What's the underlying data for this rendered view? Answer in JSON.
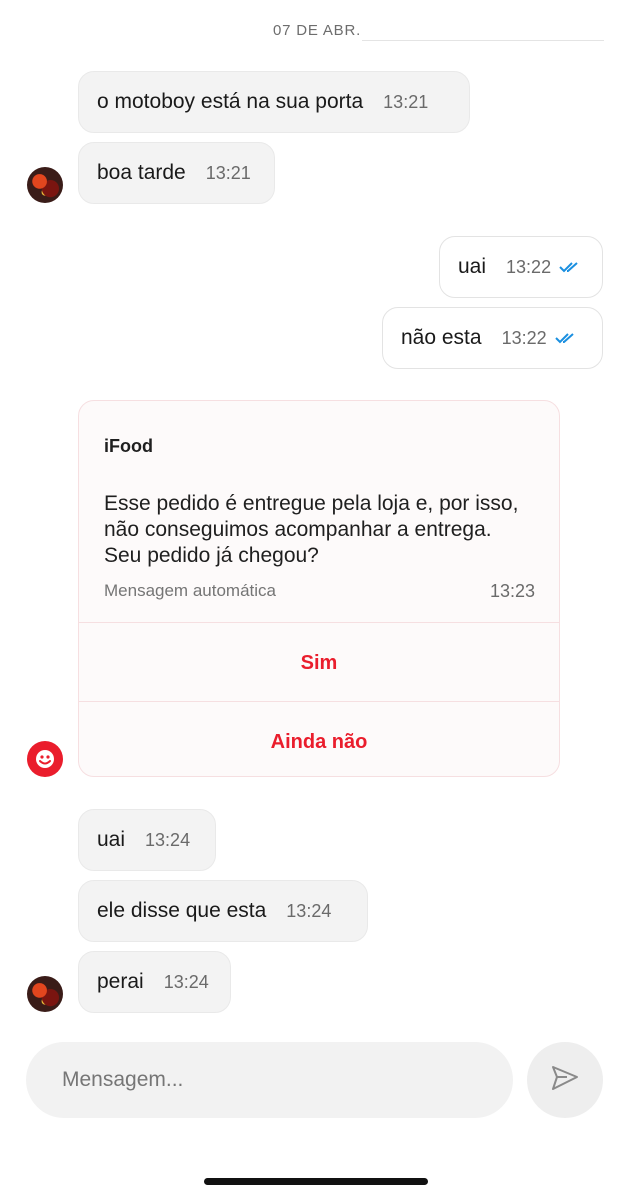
{
  "date_separator": "07 DE ABR.",
  "messages_top": [
    {
      "text": "o motoboy está na sua porta",
      "time": "13:21"
    },
    {
      "text": "boa tarde",
      "time": "13:21"
    }
  ],
  "messages_sent": [
    {
      "text": "uai",
      "time": "13:22",
      "status": "read"
    },
    {
      "text": "não esta",
      "time": "13:22",
      "status": "read"
    }
  ],
  "ifood_card": {
    "sender": "iFood",
    "text": "Esse pedido é entregue pela loja e, por isso, não conseguimos acompanhar a entrega. Seu pedido já chegou?",
    "auto_label": "Mensagem automática",
    "time": "13:23",
    "options": [
      "Sim",
      "Ainda não"
    ]
  },
  "messages_bottom": [
    {
      "text": "uai",
      "time": "13:24"
    },
    {
      "text": "ele disse que esta",
      "time": "13:24"
    },
    {
      "text": "perai",
      "time": "13:24"
    }
  ],
  "composer": {
    "placeholder": "Mensagem..."
  },
  "icons": {
    "send": "send-icon",
    "read_receipt": "double-check-icon",
    "brand": "ifood-logo-icon"
  },
  "colors": {
    "accent": "#ea1d2c",
    "read_receipt": "#1a8fe0"
  }
}
